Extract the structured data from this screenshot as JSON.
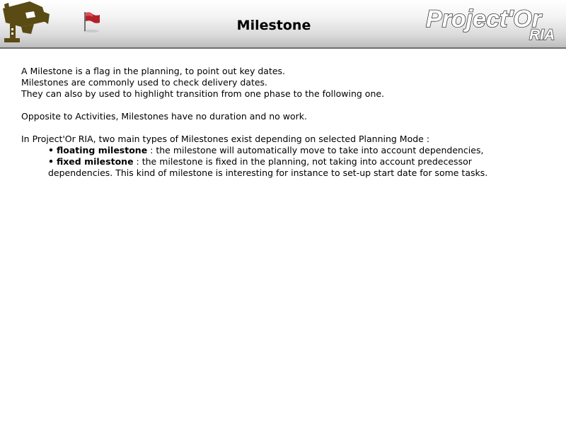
{
  "header": {
    "title": "Milestone",
    "logo_text": "Project'Or",
    "logo_subtext": "RIA",
    "left_icon": "security-camera-icon",
    "flag_icon": "milestone-flag-icon"
  },
  "content": {
    "intro_lines": [
      "A Milestone is a flag in the planning, to point out key dates.",
      "Milestones are commonly used to check delivery dates.",
      "They can also by used to highlight transition from one phase to the following one."
    ],
    "opposite_line": "Opposite to Activities, Milestones have no duration and no work.",
    "types_intro": "In Project'Or RIA, two main types of Milestones exist depending on selected Planning Mode :",
    "types": [
      {
        "bullet": "•",
        "term": "floating milestone",
        "description": " : the milestone will automatically move to take into account dependencies,"
      },
      {
        "bullet": "•",
        "term": "fixed milestone",
        "description": " : the milestone is fixed in the planning, not taking into account predecessor",
        "continuation": "dependencies. This kind of milestone is interesting for instance to set-up start date for some tasks."
      }
    ]
  },
  "colors": {
    "header_top": "#ffffff",
    "header_bottom": "#bdbdbd",
    "header_border": "#6e6e6e",
    "camera": "#5a4a14",
    "flag": "#b3202a",
    "logo_fill": "#ffffff",
    "logo_outline": "#3a3a3a",
    "text": "#000000"
  }
}
